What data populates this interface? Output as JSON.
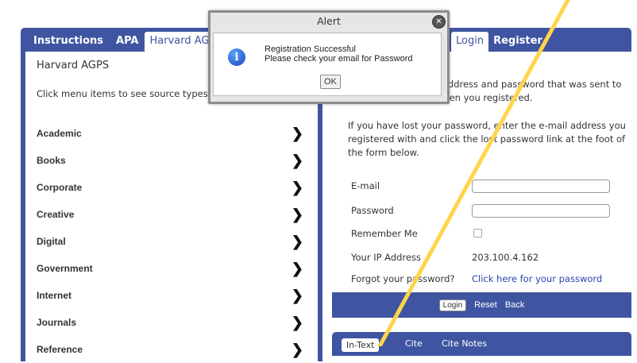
{
  "left_tabs": [
    "Instructions",
    "APA",
    "Harvard AGPS"
  ],
  "left_section": {
    "title": "Harvard AGPS",
    "hint": "Click menu items to see source types",
    "menu": [
      "Academic",
      "Books",
      "Corporate",
      "Creative",
      "Digital",
      "Government",
      "Internet",
      "Journals",
      "Reference"
    ]
  },
  "right_tabs": [
    "Login",
    "Register"
  ],
  "right_panel": {
    "heading_fragment": "re",
    "para1_line1": "l address and password that was sent to",
    "para1_line2": "the e-mail address when you registered.",
    "para2_line1": "If you have lost your password, enter the e-mail address you",
    "para2_line2": "registered with and click the lost password link at the foot of",
    "para2_line3": "the form below.",
    "email_label": "E-mail",
    "password_label": "Password",
    "remember_label": "Remember Me",
    "ip_label": "Your IP Address",
    "ip_value": "203.100.4.162",
    "forgot_label": "Forgot your password?",
    "forgot_link": "Click here for your password",
    "buttons": {
      "login": "Login",
      "reset": "Reset",
      "back": "Back"
    }
  },
  "bottom_tabs": [
    "In-Text",
    "Cite",
    "Cite Notes"
  ],
  "alert": {
    "title": "Alert",
    "line1": "Registration Successful",
    "line2": "Please check your email for Password",
    "ok": "OK"
  },
  "colors": {
    "brand": "#3f55a1",
    "link": "#2a45b0",
    "highlight_line": "#ffd54a"
  }
}
